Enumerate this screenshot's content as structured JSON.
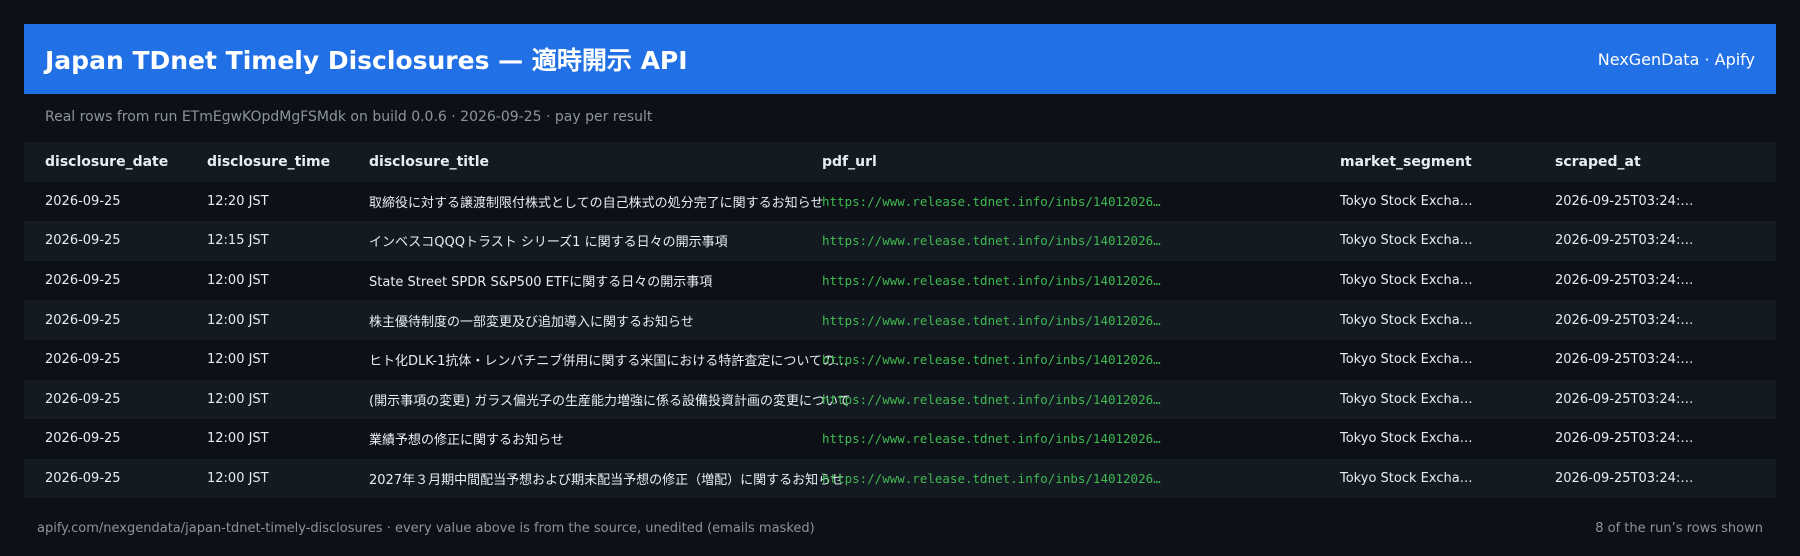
{
  "header": {
    "title": "Japan TDnet Timely Disclosures — 適時開示 API",
    "brand": "NexGenData · Apify"
  },
  "subtitle": "Real rows from run ETmEgwKOpdMgFSMdk on build 0.0.6 · 2026-09-25 · pay per result",
  "table": {
    "columns": [
      "disclosure_date",
      "disclosure_time",
      "disclosure_title",
      "pdf_url",
      "market_segment",
      "scraped_at"
    ],
    "rows": [
      [
        "2026-09-25",
        "12:20 JST",
        "取締役に対する譲渡制限付株式としての自己株式の処分完了に関するお知らせ",
        "https://www.release.tdnet.info/inbs/14012026…",
        "Tokyo Stock Excha…",
        "2026-09-25T03:24:…"
      ],
      [
        "2026-09-25",
        "12:15 JST",
        "インベスコQQQトラスト シリーズ1 に関する日々の開示事項",
        "https://www.release.tdnet.info/inbs/14012026…",
        "Tokyo Stock Excha…",
        "2026-09-25T03:24:…"
      ],
      [
        "2026-09-25",
        "12:00 JST",
        "State Street SPDR S&P500 ETFに関する日々の開示事項",
        "https://www.release.tdnet.info/inbs/14012026…",
        "Tokyo Stock Excha…",
        "2026-09-25T03:24:…"
      ],
      [
        "2026-09-25",
        "12:00 JST",
        "株主優待制度の一部変更及び追加導入に関するお知らせ",
        "https://www.release.tdnet.info/inbs/14012026…",
        "Tokyo Stock Excha…",
        "2026-09-25T03:24:…"
      ],
      [
        "2026-09-25",
        "12:00 JST",
        "ヒト化DLK-1抗体・レンバチニブ併用に関する米国における特許査定についての…",
        "https://www.release.tdnet.info/inbs/14012026…",
        "Tokyo Stock Excha…",
        "2026-09-25T03:24:…"
      ],
      [
        "2026-09-25",
        "12:00 JST",
        "(開示事項の変更) ガラス偏光子の生産能力増強に係る設備投資計画の変更について",
        "https://www.release.tdnet.info/inbs/14012026…",
        "Tokyo Stock Excha…",
        "2026-09-25T03:24:…"
      ],
      [
        "2026-09-25",
        "12:00 JST",
        "業績予想の修正に関するお知らせ",
        "https://www.release.tdnet.info/inbs/14012026…",
        "Tokyo Stock Excha…",
        "2026-09-25T03:24:…"
      ],
      [
        "2026-09-25",
        "12:00 JST",
        "2027年３月期中間配当予想および期末配当予想の修正（増配）に関するお知らせ",
        "https://www.release.tdnet.info/inbs/14012026…",
        "Tokyo Stock Excha…",
        "2026-09-25T03:24:…"
      ]
    ]
  },
  "footer": {
    "left": "apify.com/nexgendata/japan-tdnet-timely-disclosures  ·  every value above is from the source, unedited (emails masked)",
    "right": "8 of the run’s rows shown"
  },
  "colors": {
    "background": "#0d1117",
    "header_bg": "#2170e6",
    "url_text": "#3fb950",
    "muted_text": "#8b949e"
  }
}
